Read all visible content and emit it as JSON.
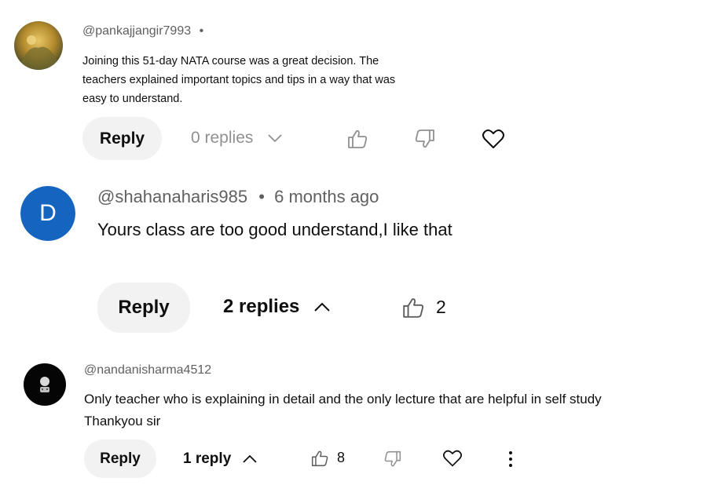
{
  "comments": [
    {
      "author": "@pankajjangir7993",
      "separator": "•",
      "text_lines": [
        "Joining this 51-day NATA course was a great decision. The",
        "teachers explained important topics and tips in a way that was",
        "easy to understand."
      ],
      "reply_label": "Reply",
      "replies_label": "0 replies"
    },
    {
      "author": "@shahanaharis985",
      "separator": "•",
      "timestamp": "6 months ago",
      "avatar_letter": "D",
      "avatar_color": "#1565c0",
      "text": "Yours class are too good understand,I like that",
      "reply_label": "Reply",
      "replies_label": "2 replies",
      "like_count": "2"
    },
    {
      "author": "@nandanisharma4512",
      "text_lines": [
        "Only teacher who is explaining in detail and the only lecture that are helpful in self study",
        "Thankyou sir"
      ],
      "reply_label": "Reply",
      "replies_label": "1 reply",
      "like_count": "8"
    }
  ]
}
